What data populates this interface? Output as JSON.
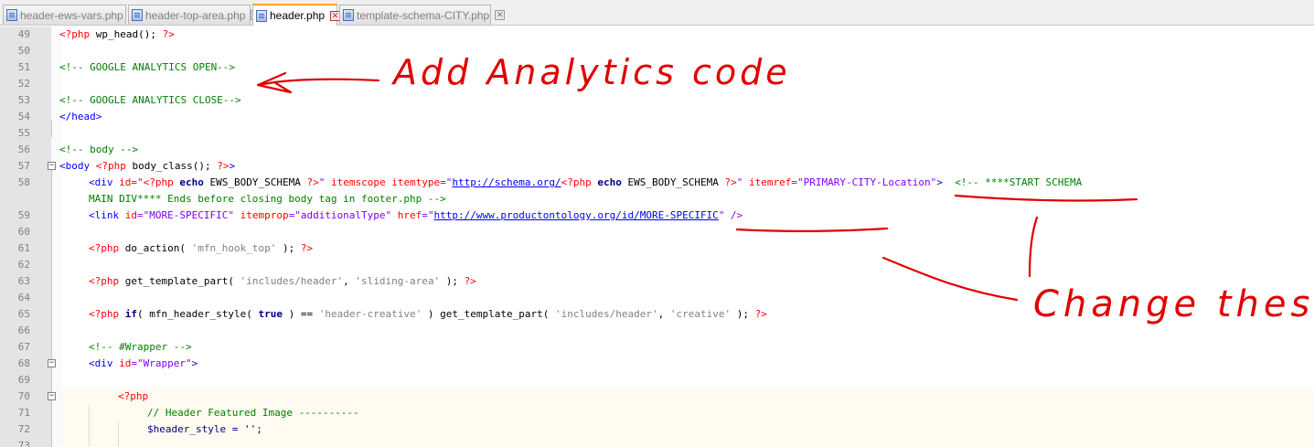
{
  "tabs": [
    {
      "label": "header-ews-vars.php",
      "close": "✕"
    },
    {
      "label": "header-top-area.php",
      "close": "✕"
    },
    {
      "label": "header.php",
      "close": "✕",
      "active": true
    },
    {
      "label": "template-schema-CITY.php",
      "close": "✕"
    }
  ],
  "editor": {
    "line_numbers": [
      "49",
      "50",
      "51",
      "52",
      "53",
      "54",
      "55",
      "56",
      "57",
      "58",
      "",
      "59",
      "60",
      "61",
      "62",
      "63",
      "64",
      "65",
      "66",
      "67",
      "68",
      "69",
      "70",
      "71",
      "72",
      "73"
    ],
    "lines": {
      "l49": [
        "<?php",
        " wp_head(); ",
        "?>"
      ],
      "l51": "<!-- GOOGLE ANALYTICS OPEN-->",
      "l53": "<!-- GOOGLE ANALYTICS CLOSE-->",
      "l54": "</head>",
      "l56": "<!-- body -->",
      "l57": [
        "<body ",
        "<?php",
        " body_class(); ",
        "?>",
        ">"
      ],
      "l58": [
        "<div ",
        "id",
        "=\"",
        "<?php",
        " echo",
        " EWS_BODY_SCHEMA ",
        "?>",
        "\" ",
        "itemscope itemtype",
        "=\"",
        "http://schema.org/",
        "<?php",
        " echo",
        " EWS_BODY_SCHEMA ",
        "?>",
        "\" ",
        "itemref",
        "=\"PRIMARY-CITY-Location\"",
        ">  ",
        "<!-- ****START SCHEMA"
      ],
      "l58b": "MAIN DIV**** Ends before closing body tag in footer.php -->",
      "l59": [
        "<link ",
        "id",
        "=\"MORE-SPECIFIC\" ",
        "itemprop",
        "=\"additionalType\" ",
        "href",
        "=\"",
        "http://www.productontology.org/id/MORE-SPECIFIC",
        "\" />"
      ],
      "l61": [
        "<?php",
        " do_action( ",
        "'mfn_hook_top'",
        " ); ",
        "?>"
      ],
      "l63": [
        "<?php",
        " get_template_part( ",
        "'includes/header'",
        ", ",
        "'sliding-area'",
        " ); ",
        "?>"
      ],
      "l65": [
        "<?php",
        " if",
        "( mfn_header_style( ",
        "true",
        " ) == ",
        "'header-creative'",
        " ) get_template_part( ",
        "'includes/header'",
        ", ",
        "'creative'",
        " ); ",
        "?>"
      ],
      "l67": "<!-- #Wrapper -->",
      "l68": [
        "<div ",
        "id",
        "=\"Wrapper\"",
        ">"
      ],
      "l70": "<?php",
      "l71": "// Header Featured Image ----------",
      "l72": "$header_style = '';"
    }
  },
  "annotations": {
    "note1": "Add Analytics code",
    "note2": "Change these",
    "ink_color": "#e00000"
  }
}
